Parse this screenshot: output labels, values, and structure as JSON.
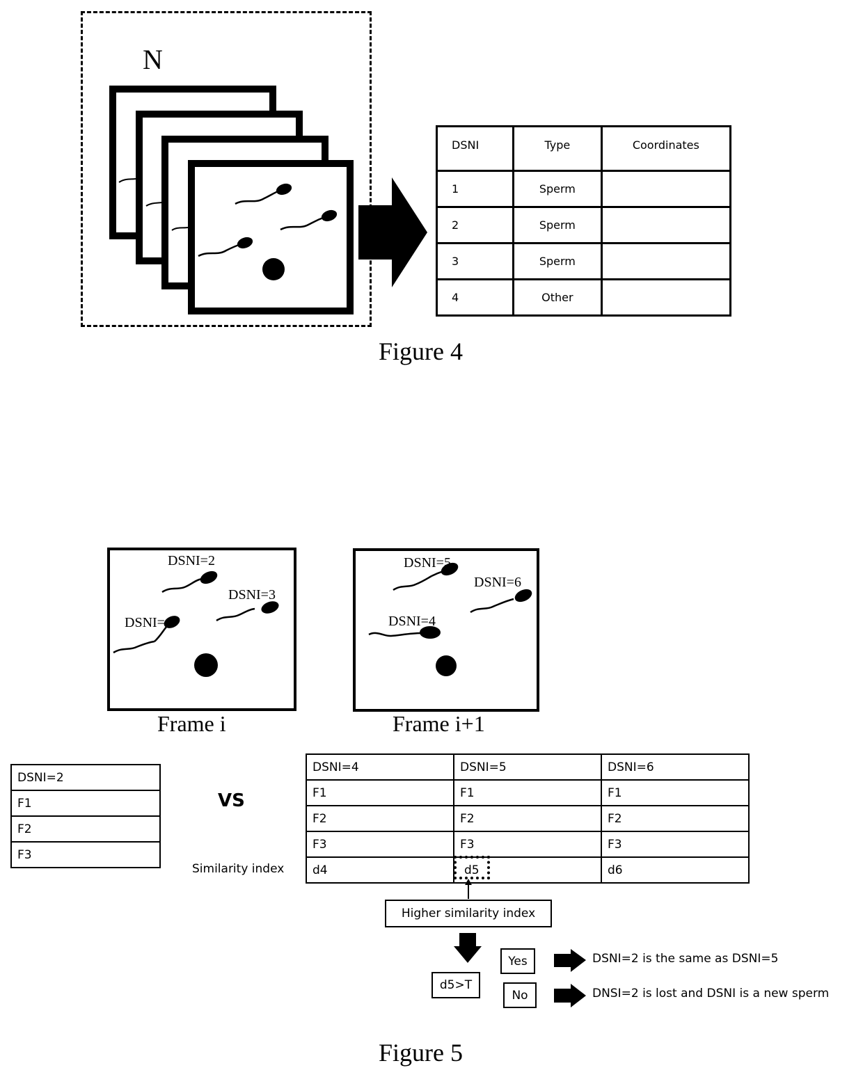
{
  "figure4": {
    "caption": "Figure 4",
    "stack_label": "N",
    "table": {
      "headers": [
        "DSNI",
        "Type",
        "Coordinates"
      ],
      "rows": [
        [
          "1",
          "Sperm",
          ""
        ],
        [
          "2",
          "Sperm",
          ""
        ],
        [
          "3",
          "Sperm",
          ""
        ],
        [
          "4",
          "Other",
          ""
        ]
      ]
    }
  },
  "figure5": {
    "caption": "Figure 5",
    "frames": [
      {
        "title": "Frame i",
        "labels": [
          "DSNI=2",
          "DSNI=3",
          "DSNI=1"
        ]
      },
      {
        "title": "Frame i+1",
        "labels": [
          "DSNI=5",
          "DSNI=6",
          "DSNI=4"
        ]
      }
    ],
    "left_table": [
      "DSNI=2",
      "F1",
      "F2",
      "F3"
    ],
    "vs_label": "VS",
    "similarity_label": "Similarity index",
    "right_table": {
      "headers": [
        "DSNI=4",
        "DSNI=5",
        "DSNI=6"
      ],
      "rows": [
        [
          "F1",
          "F1",
          "F1"
        ],
        [
          "F2",
          "F2",
          "F2"
        ],
        [
          "F3",
          "F3",
          "F3"
        ],
        [
          "d4",
          "d5",
          "d6"
        ]
      ]
    },
    "highlight_box": "Higher similarity index",
    "condition": "d5>T",
    "yes_label": "Yes",
    "no_label": "No",
    "yes_result": "DSNI=2 is the same as DSNI=5",
    "no_result": "DNSI=2 is lost and DSNI is a new sperm"
  }
}
